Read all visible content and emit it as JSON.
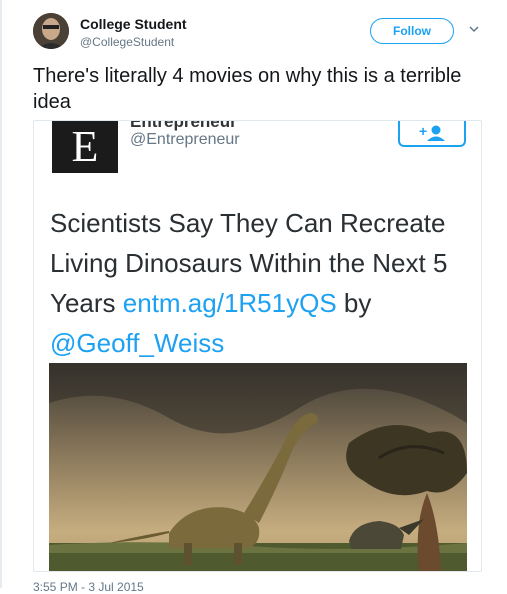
{
  "author": {
    "display_name": "College Student",
    "handle": "@CollegeStudent",
    "follow_label": "Follow"
  },
  "tweet": {
    "text": "There's literally 4 movies on why this is a terrible idea",
    "timestamp": "3:55 PM - 3 Jul 2015"
  },
  "embedded": {
    "logo_letter": "E",
    "account_name": "Entrepreneur",
    "account_handle": "@Entrepreneur",
    "headline_text": "Scientists Say They Can Recreate Living Dinosaurs Within the Next 5 Years",
    "headline_link": "entm.ag/1R51yQS",
    "headline_by": "by",
    "headline_mention": "@Geoff_Weiss"
  },
  "icons": {
    "caret": "chevron-down-icon",
    "follow": "add-user-icon"
  },
  "colors": {
    "accent": "#1da1f2",
    "text": "#14171a",
    "muted": "#657786"
  }
}
